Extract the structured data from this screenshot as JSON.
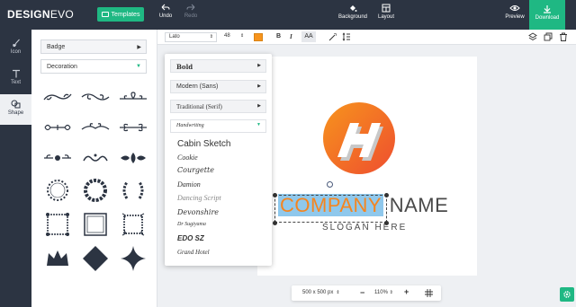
{
  "app": {
    "logo_bold": "DESIGN",
    "logo_light": "EVO"
  },
  "topbar": {
    "templates_label": "Templates",
    "undo_label": "Undo",
    "redo_label": "Redo",
    "background_label": "Background",
    "layout_label": "Layout",
    "preview_label": "Preview",
    "download_label": "Download"
  },
  "leftnav": {
    "items": [
      {
        "label": "Icon",
        "icon": "icon-icon"
      },
      {
        "label": "Text",
        "icon": "text-icon"
      },
      {
        "label": "Shape",
        "icon": "shape-icon",
        "active": true
      }
    ]
  },
  "panel": {
    "category_badge": "Badge",
    "category_decoration": "Decoration",
    "shapes": [
      "ornament-flourish-1",
      "ornament-flourish-2",
      "ornament-flourish-3",
      "ornament-flourish-4",
      "ornament-flourish-5",
      "ornament-flourish-6",
      "ornament-flourish-7",
      "ornament-flourish-8",
      "ornament-flourish-9",
      "laurel-wreath-dotted",
      "laurel-wreath-bold",
      "laurel-wreath-leaves",
      "ornate-frame-1",
      "ornate-frame-2",
      "ornate-frame-3",
      "crown-shape",
      "diamond-shape",
      "four-point-star-shape"
    ]
  },
  "texttoolbar": {
    "font": "Lato",
    "size": "48",
    "color": "#f7941d",
    "bold": "B",
    "italic": "I",
    "case": "AA"
  },
  "fontdropdown": {
    "categories": [
      {
        "label": "Bold"
      },
      {
        "label": "Modern (Sans)"
      },
      {
        "label": "Traditional (Serif)"
      },
      {
        "label": "Handwriting",
        "open": true
      }
    ],
    "fonts": [
      "Cabin Sketch",
      "Cookie",
      "Courgette",
      "Damion",
      "Dancing Script",
      "Devonshire",
      "Dr Sugiyama",
      "EDO SZ",
      "Grand Hotel"
    ]
  },
  "canvas": {
    "company_highlight": "COMPANY",
    "company_rest": " NAME",
    "slogan": "SLOGAN HERE",
    "logo_circle_color": "#f16a2a",
    "highlight_color": "#8fc8ec"
  },
  "zoombar": {
    "canvas_size": "500 x 500 px",
    "minus": "−",
    "zoom": "110%",
    "plus": "+"
  },
  "colors": {
    "dark": "#2c3442",
    "accent": "#1fb883",
    "orange": "#f7941d"
  }
}
